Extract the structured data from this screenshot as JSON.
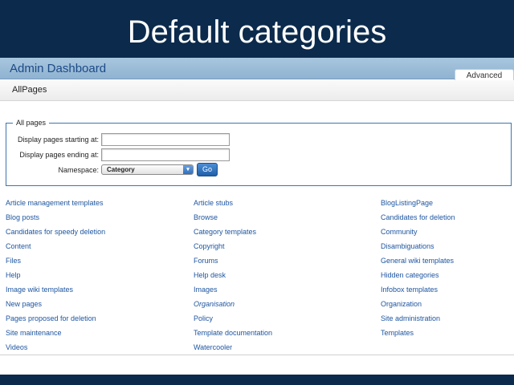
{
  "slide": {
    "title": "Default categories"
  },
  "dashboard": {
    "title": "Admin Dashboard",
    "tab_advanced": "Advanced",
    "page_heading": "AllPages"
  },
  "form": {
    "legend": "All pages",
    "start_label": "Display pages starting at:",
    "start_value": "",
    "end_label": "Display pages ending at:",
    "end_value": "",
    "namespace_label": "Namespace:",
    "namespace_selected": "Category",
    "go_label": "Go"
  },
  "categories": {
    "col1": [
      {
        "text": "Article management templates",
        "italic": false
      },
      {
        "text": "Blog posts",
        "italic": false
      },
      {
        "text": "Candidates for speedy deletion",
        "italic": false
      },
      {
        "text": "Content",
        "italic": false
      },
      {
        "text": "Files",
        "italic": false
      },
      {
        "text": "Help",
        "italic": false
      },
      {
        "text": "Image wiki templates",
        "italic": false
      },
      {
        "text": "New pages",
        "italic": false
      },
      {
        "text": "Pages proposed for deletion",
        "italic": false
      },
      {
        "text": "Site maintenance",
        "italic": false
      },
      {
        "text": "Videos",
        "italic": false
      }
    ],
    "col2": [
      {
        "text": "Article stubs",
        "italic": false
      },
      {
        "text": "Browse",
        "italic": false
      },
      {
        "text": "Category templates",
        "italic": false
      },
      {
        "text": "Copyright",
        "italic": false
      },
      {
        "text": "Forums",
        "italic": false
      },
      {
        "text": "Help desk",
        "italic": false
      },
      {
        "text": "Images",
        "italic": false
      },
      {
        "text": "Organisation",
        "italic": true
      },
      {
        "text": "Policy",
        "italic": false
      },
      {
        "text": "Template documentation",
        "italic": false
      },
      {
        "text": "Watercooler",
        "italic": false
      }
    ],
    "col3": [
      {
        "text": "BlogListingPage",
        "italic": false
      },
      {
        "text": "Candidates for deletion",
        "italic": false
      },
      {
        "text": "Community",
        "italic": false
      },
      {
        "text": "Disambiguations",
        "italic": false
      },
      {
        "text": "General wiki templates",
        "italic": false
      },
      {
        "text": "Hidden categories",
        "italic": false
      },
      {
        "text": "Infobox templates",
        "italic": false
      },
      {
        "text": "Organization",
        "italic": false
      },
      {
        "text": "Site administration",
        "italic": false
      },
      {
        "text": "Templates",
        "italic": false
      }
    ]
  },
  "colors": {
    "slide_bg": "#0b2a4c",
    "link": "#1f56a0",
    "header_title": "#1c4a86",
    "fieldset_border": "#3f74ad"
  }
}
